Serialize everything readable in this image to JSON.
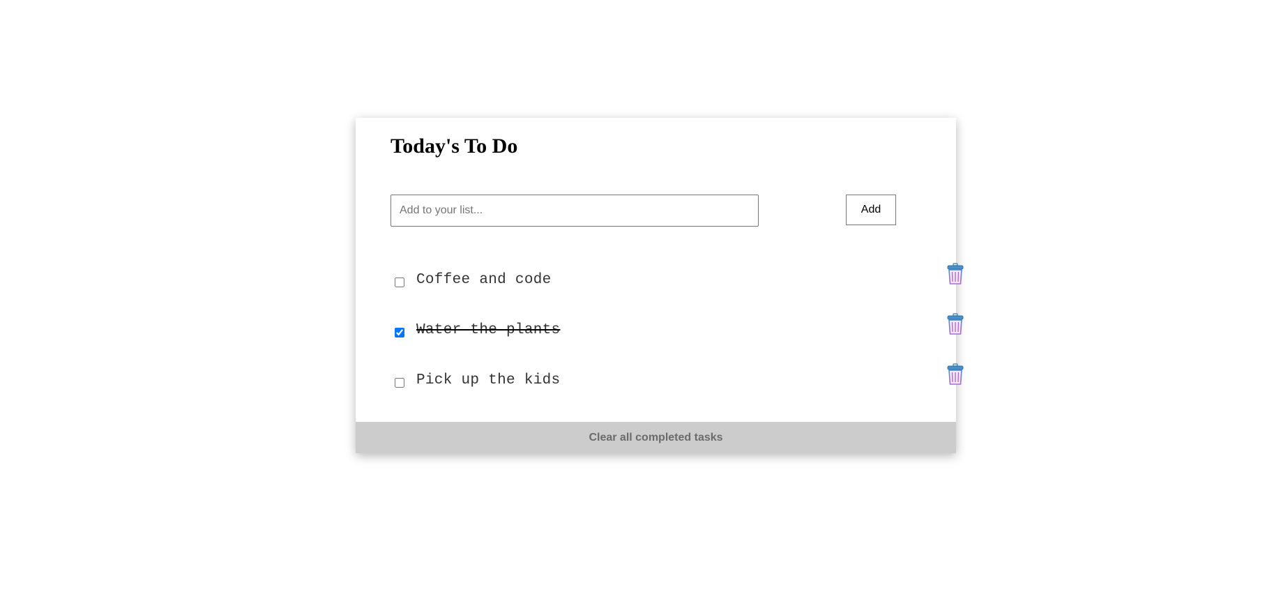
{
  "header": {
    "title": "Today's To Do"
  },
  "new_task": {
    "value": "",
    "placeholder": "Add to your list...",
    "add_label": "Add"
  },
  "tasks": [
    {
      "label": "Coffee and code",
      "completed": false,
      "delete_icon": "trash-can-icon"
    },
    {
      "label": "Water the plants",
      "completed": true,
      "delete_icon": "trash-can-icon"
    },
    {
      "label": "Pick up the kids",
      "completed": false,
      "delete_icon": "trash-can-icon"
    }
  ],
  "footer": {
    "clear_label": "Clear all completed tasks"
  },
  "colors": {
    "footer_background": "#cccccc",
    "checkbox_accent": "#0075ff",
    "trash_lid": "#4a90c8",
    "trash_body": "#b067d6"
  }
}
